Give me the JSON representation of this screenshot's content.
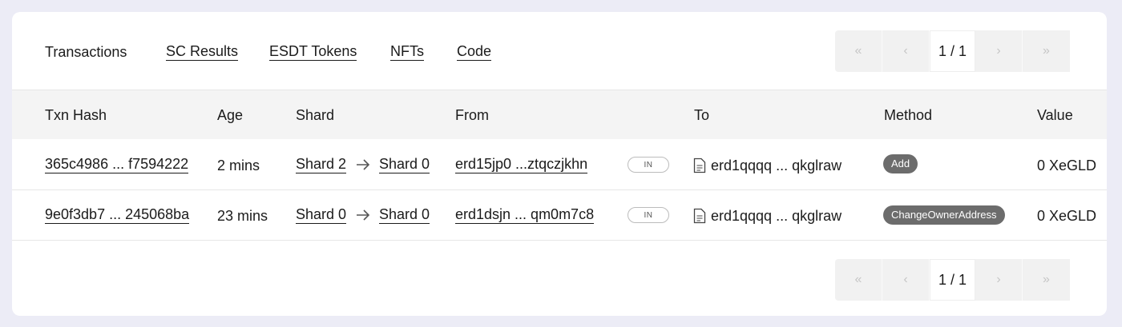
{
  "tabs": [
    {
      "label": "Transactions",
      "active": true
    },
    {
      "label": "SC Results"
    },
    {
      "label": "ESDT Tokens"
    },
    {
      "label": "NFTs"
    },
    {
      "label": "Code"
    }
  ],
  "pager": {
    "first": "«",
    "prev": "‹",
    "page": "1 / 1",
    "next": "›",
    "last": "»"
  },
  "columns": [
    "Txn Hash",
    "Age",
    "Shard",
    "From",
    "To",
    "Method",
    "Value"
  ],
  "rows": [
    {
      "hash": "365c4986 ... f7594222",
      "age": "2 mins",
      "shard_from": "Shard 2",
      "shard_to": "Shard 0",
      "from": "erd15jp0 ...ztqczjkhn",
      "direction": "IN",
      "to": "erd1qqqq ... qkglraw",
      "method": "Add",
      "value": "0 XeGLD"
    },
    {
      "hash": "9e0f3db7 ... 245068ba",
      "age": "23 mins",
      "shard_from": "Shard 0",
      "shard_to": "Shard 0",
      "from": "erd1dsjn ... qm0m7c8",
      "direction": "IN",
      "to": "erd1qqqq ... qkglraw",
      "method": "ChangeOwnerAddress",
      "value": "0 XeGLD"
    }
  ],
  "colors": {
    "background": "#ececf6",
    "card": "#ffffff",
    "header": "#f4f4f4",
    "badge": "#6c6c6c"
  }
}
